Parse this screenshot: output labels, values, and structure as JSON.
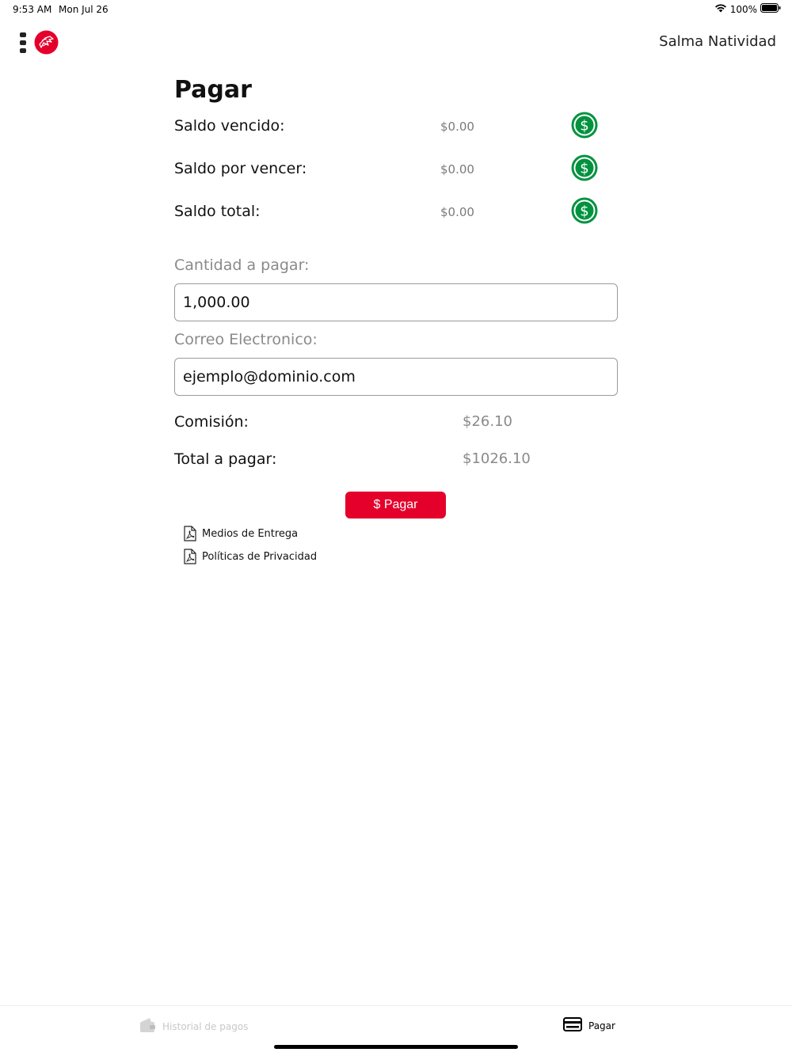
{
  "status_bar": {
    "time": "9:53 AM",
    "date": "Mon Jul 26",
    "battery": "100%"
  },
  "header": {
    "user_name": "Salma Natividad"
  },
  "page": {
    "title": "Pagar"
  },
  "balances": [
    {
      "label": "Saldo vencido:",
      "value": "$0.00"
    },
    {
      "label": "Saldo por vencer:",
      "value": "$0.00"
    },
    {
      "label": "Saldo total:",
      "value": "$0.00"
    }
  ],
  "form": {
    "amount_label": "Cantidad a pagar:",
    "amount_value": "1,000.00",
    "email_label": "Correo Electronico:",
    "email_value": "ejemplo@dominio.com"
  },
  "summary": {
    "commission_label": "Comisión:",
    "commission_value": "$26.10",
    "total_label": "Total a pagar:",
    "total_value": "$1026.10"
  },
  "pay_button": {
    "label": "$ Pagar",
    "color": "#e4002b"
  },
  "documents": [
    {
      "label": "Medios de Entrega",
      "icon": "pdf-icon"
    },
    {
      "label": "Políticas de Privacidad",
      "icon": "pdf-icon"
    }
  ],
  "tab_bar": {
    "history_label": "Historial de pagos",
    "pay_label": "Pagar"
  },
  "colors": {
    "accent": "#e4002b",
    "pay_icon": "#00923f"
  }
}
